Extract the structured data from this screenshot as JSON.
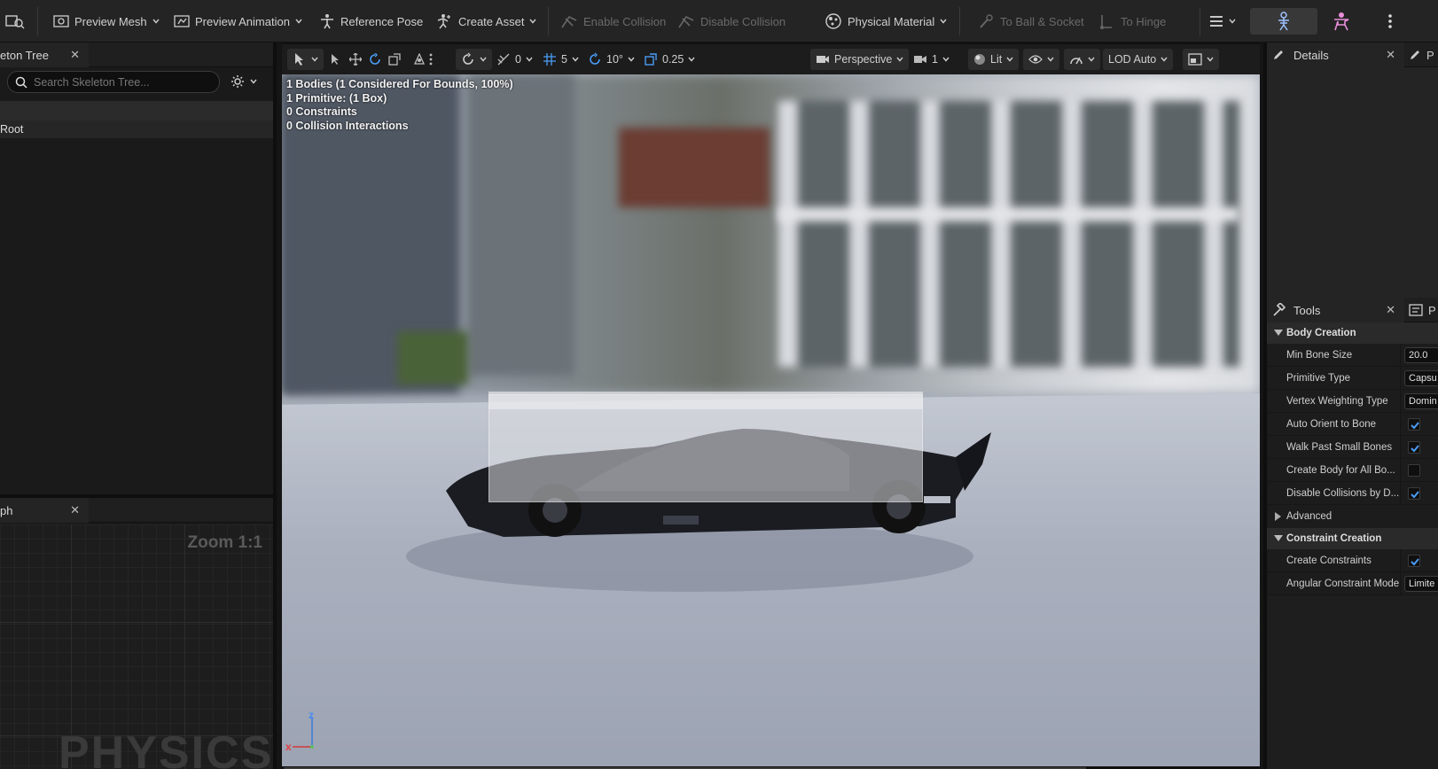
{
  "toolbar": {
    "preview_mesh": "Preview Mesh",
    "preview_animation": "Preview Animation",
    "reference_pose": "Reference Pose",
    "create_asset": "Create Asset",
    "enable_collision": "Enable Collision",
    "disable_collision": "Disable Collision",
    "physical_material": "Physical Material",
    "to_ball_socket": "To Ball & Socket",
    "to_hinge": "To Hinge"
  },
  "skeleton_tree": {
    "tab_label": "eton Tree",
    "search_placeholder": "Search Skeleton Tree...",
    "rows": [
      "Root"
    ]
  },
  "graph": {
    "tab_label": "ph",
    "zoom": "Zoom 1:1",
    "watermark": "PHYSICS"
  },
  "viewport": {
    "transform": {
      "translate_snap": "0",
      "grid_snap": "5",
      "rotate_snap": "10°",
      "scale_snap": "0.25"
    },
    "view_mode": "Perspective",
    "camera_speed": "1",
    "lighting": "Lit",
    "lod": "LOD Auto",
    "stats": [
      "1 Bodies (1 Considered For Bounds, 100%)",
      "1 Primitive: (1 Box)",
      "0 Constraints",
      "0 Collision Interactions"
    ],
    "axis": {
      "x": "x",
      "z": "z"
    }
  },
  "details": {
    "tab_label": "Details",
    "side_tab": "P"
  },
  "tools": {
    "tab_label": "Tools",
    "side_tab": "P",
    "body_creation": "Body Creation",
    "constraint_creation": "Constraint Creation",
    "advanced": "Advanced",
    "props": {
      "min_bone_size": {
        "label": "Min Bone Size",
        "value": "20.0"
      },
      "primitive_type": {
        "label": "Primitive Type",
        "value": "Capsu"
      },
      "vertex_weighting": {
        "label": "Vertex Weighting Type",
        "value": "Domin"
      },
      "auto_orient": {
        "label": "Auto Orient to Bone",
        "checked": true
      },
      "walk_past": {
        "label": "Walk Past Small Bones",
        "checked": true
      },
      "create_body_all": {
        "label": "Create Body for All Bo...",
        "checked": false
      },
      "disable_collisions": {
        "label": "Disable Collisions by D...",
        "checked": true
      },
      "create_constraints": {
        "label": "Create Constraints",
        "checked": true
      },
      "angular_mode": {
        "label": "Angular Constraint Mode",
        "value": "Limite"
      }
    }
  },
  "colors": {
    "accent": "#3b82f6",
    "check": "#4a9cf5"
  }
}
